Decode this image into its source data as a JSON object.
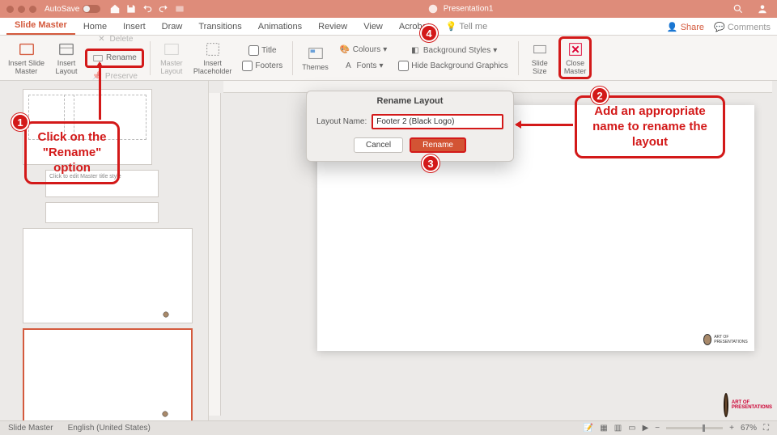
{
  "titlebar": {
    "autosave": "AutoSave",
    "title": "Presentation1"
  },
  "tabs": {
    "items": [
      "Slide Master",
      "Home",
      "Insert",
      "Draw",
      "Transitions",
      "Animations",
      "Review",
      "View",
      "Acrobat",
      "Tell me"
    ],
    "share": "Share",
    "comments": "Comments"
  },
  "ribbon": {
    "insert_slide_master": "Insert Slide\nMaster",
    "insert_layout": "Insert\nLayout",
    "delete": "Delete",
    "rename": "Rename",
    "preserve": "Preserve",
    "master_layout": "Master\nLayout",
    "insert_placeholder": "Insert\nPlaceholder",
    "title_cb": "Title",
    "footers_cb": "Footers",
    "themes": "Themes",
    "colours": "Colours",
    "fonts": "Fonts",
    "bg_styles": "Background Styles",
    "hide_bg": "Hide Background Graphics",
    "slide_size": "Slide\nSize",
    "close_master": "Close\nMaster"
  },
  "thumbs": {
    "layout_text": "Click to edit Master title style"
  },
  "dialog": {
    "title": "Rename Layout",
    "label": "Layout Name:",
    "value": "Footer 2 (Black Logo)",
    "cancel": "Cancel",
    "rename": "Rename"
  },
  "callouts": {
    "c1": "Click on the \"Rename\" option",
    "c2": "Add an appropriate name to rename the layout"
  },
  "status": {
    "mode": "Slide Master",
    "lang": "English (United States)",
    "zoom": "67%"
  },
  "brand": {
    "name": "ART OF PRESENTATIONS"
  }
}
